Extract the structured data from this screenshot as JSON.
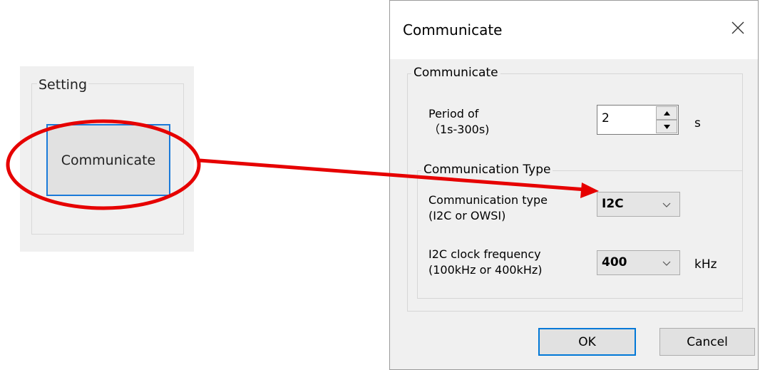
{
  "setting_panel": {
    "group_label": "Setting",
    "button_label": "Communicate"
  },
  "dialog": {
    "title": "Communicate",
    "close_icon": "close-icon",
    "group_communicate": {
      "legend": "Communicate",
      "period_label_line1": "Period of",
      "period_label_line2": "（1s-300s)",
      "period_value": "2",
      "period_unit": "s"
    },
    "group_type": {
      "legend": "Communication Type",
      "type_label_line1": "Communication type",
      "type_label_line2": "(I2C or OWSI)",
      "type_value": "I2C",
      "clock_label_line1": "I2C clock frequency",
      "clock_label_line2": "(100kHz or 400kHz)",
      "clock_value": "400",
      "clock_unit": "kHz"
    },
    "ok_label": "OK",
    "cancel_label": "Cancel"
  },
  "annotation": {
    "highlight_color": "#e60000",
    "focus_border_color": "#1a7ad9"
  }
}
